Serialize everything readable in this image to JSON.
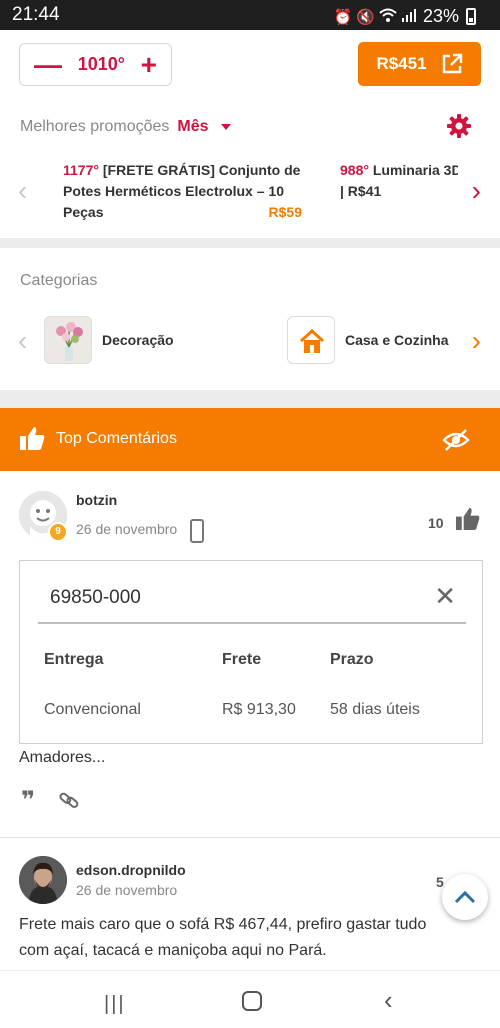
{
  "status_bar": {
    "time": "21:44",
    "battery": "23%"
  },
  "top_bar": {
    "temperature": "1010°",
    "minus": "—",
    "plus": "+",
    "price": "R$451"
  },
  "promotions": {
    "heading": "Melhores promoções",
    "period": "Mês",
    "deals": [
      {
        "temp": "1177°",
        "title": "[FRETE GRÁTIS] Conjunto de Potes Herméticos Electrolux – 10 Peças",
        "price": "R$59"
      },
      {
        "temp": "988°",
        "title": "Luminaria 3D",
        "price": "| R$41"
      }
    ]
  },
  "categories": {
    "heading": "Categorias",
    "items": [
      {
        "label": "Decoração"
      },
      {
        "label": "Casa e Cozinha"
      }
    ]
  },
  "top_comments": {
    "label": "Top Comentários"
  },
  "comments": [
    {
      "user": "botzin",
      "date": "26 de novembro",
      "likes": "10",
      "badge": "9",
      "shipping": {
        "cep": "69850-000",
        "headers": [
          "Entrega",
          "Frete",
          "Prazo"
        ],
        "row": [
          "Convencional",
          "R$ 913,30",
          "58 dias úteis"
        ]
      },
      "text": "Amadores..."
    },
    {
      "user": "edson.dropnildo",
      "date": "26 de novembro",
      "likes": "5",
      "text": "Frete mais caro que o sofá R$ 467,44, prefiro gastar tudo com açaí, tacacá e maniçoba aqui no Pará."
    }
  ],
  "colors": {
    "accent_orange": "#f57c00",
    "accent_red": "#d1143f",
    "divider": "#ececec"
  },
  "icons": [
    "alarm-icon",
    "mute-icon",
    "wifi-icon",
    "signal-icon",
    "battery-icon",
    "external-link-icon",
    "gear-icon",
    "thumbs-up-icon",
    "eye-off-icon",
    "phone-icon",
    "close-icon",
    "quote-icon",
    "link-icon",
    "chevron-up-icon"
  ]
}
